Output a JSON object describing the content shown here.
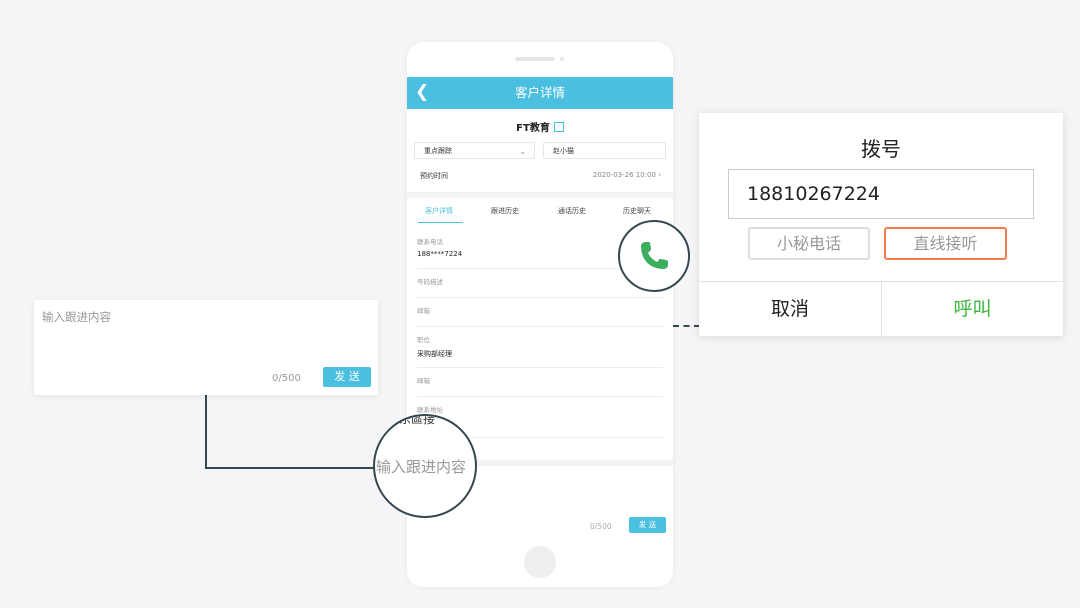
{
  "app": {
    "nav_title": "客户详情",
    "back_icon": "chevron-left-icon",
    "accent_color": "#4bbfe0"
  },
  "customer": {
    "company": "FT教育",
    "priority_select": "重点跟踪",
    "owner": "赵小猫",
    "appointment_label": "预约时间",
    "appointment_value": "2020-03-26 10:00"
  },
  "tabs": [
    {
      "label": "客户详情",
      "active": true
    },
    {
      "label": "跟进历史",
      "active": false
    },
    {
      "label": "通话历史",
      "active": false
    },
    {
      "label": "历史聊天",
      "active": false
    }
  ],
  "fields": [
    {
      "label": "联系电话",
      "value": "188****7224"
    },
    {
      "label": "号码描述",
      "value": ""
    },
    {
      "label": "邮箱",
      "value": ""
    },
    {
      "label": "职位",
      "value": "采购部经理"
    },
    {
      "label": "邮箱",
      "value": ""
    },
    {
      "label": "联系地址",
      "value": ""
    }
  ],
  "followup": {
    "placeholder": "输入跟进内容",
    "counter": "0/500",
    "send_label": "发 送"
  },
  "magnifier": {
    "text": "输入跟进内容",
    "fragment": "东區接"
  },
  "dialer": {
    "title": "拨号",
    "number": "18810267224",
    "option_secretary": "小秘电话",
    "option_direct": "直线接听",
    "selected_color": "#ef7d4e",
    "cancel": "取消",
    "call": "呼叫",
    "call_color": "#3cb83c",
    "phone_icon_color": "#3dae5e"
  }
}
